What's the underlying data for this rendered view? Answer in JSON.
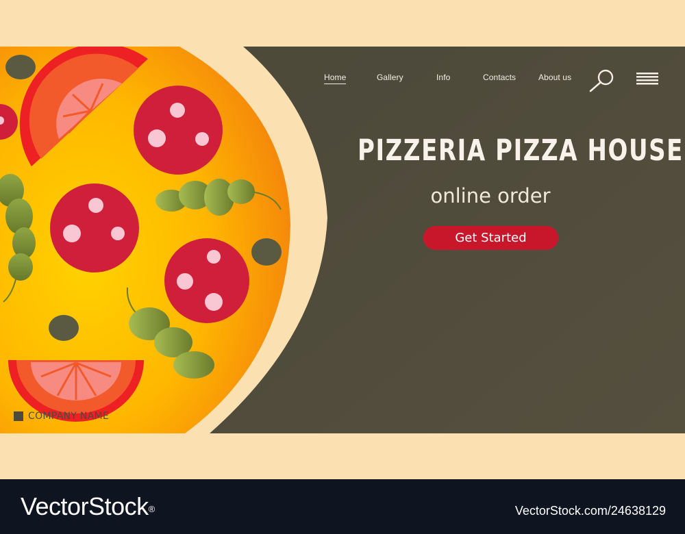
{
  "nav": {
    "items": [
      {
        "label": "Home",
        "active": true
      },
      {
        "label": "Gallery"
      },
      {
        "label": "Info"
      },
      {
        "label": "Contacts"
      },
      {
        "label": "About us"
      }
    ]
  },
  "icons": {
    "search": "search-icon",
    "menu": "hamburger-menu-icon"
  },
  "hero": {
    "title": "PIZZERIA PIZZA HOUSE",
    "subtitle": "online order",
    "cta_label": "Get Started",
    "company_name": "COMPANY NAME"
  },
  "footer": {
    "brand": "VectorStock",
    "brand_mark": "®",
    "image_id": "VectorStock.com/24638129"
  },
  "colors": {
    "background": "#fbe0b1",
    "panel": "#4e4a3a",
    "accent": "#c8172b",
    "pizza": "#f7a700",
    "footer": "#0f1421"
  }
}
